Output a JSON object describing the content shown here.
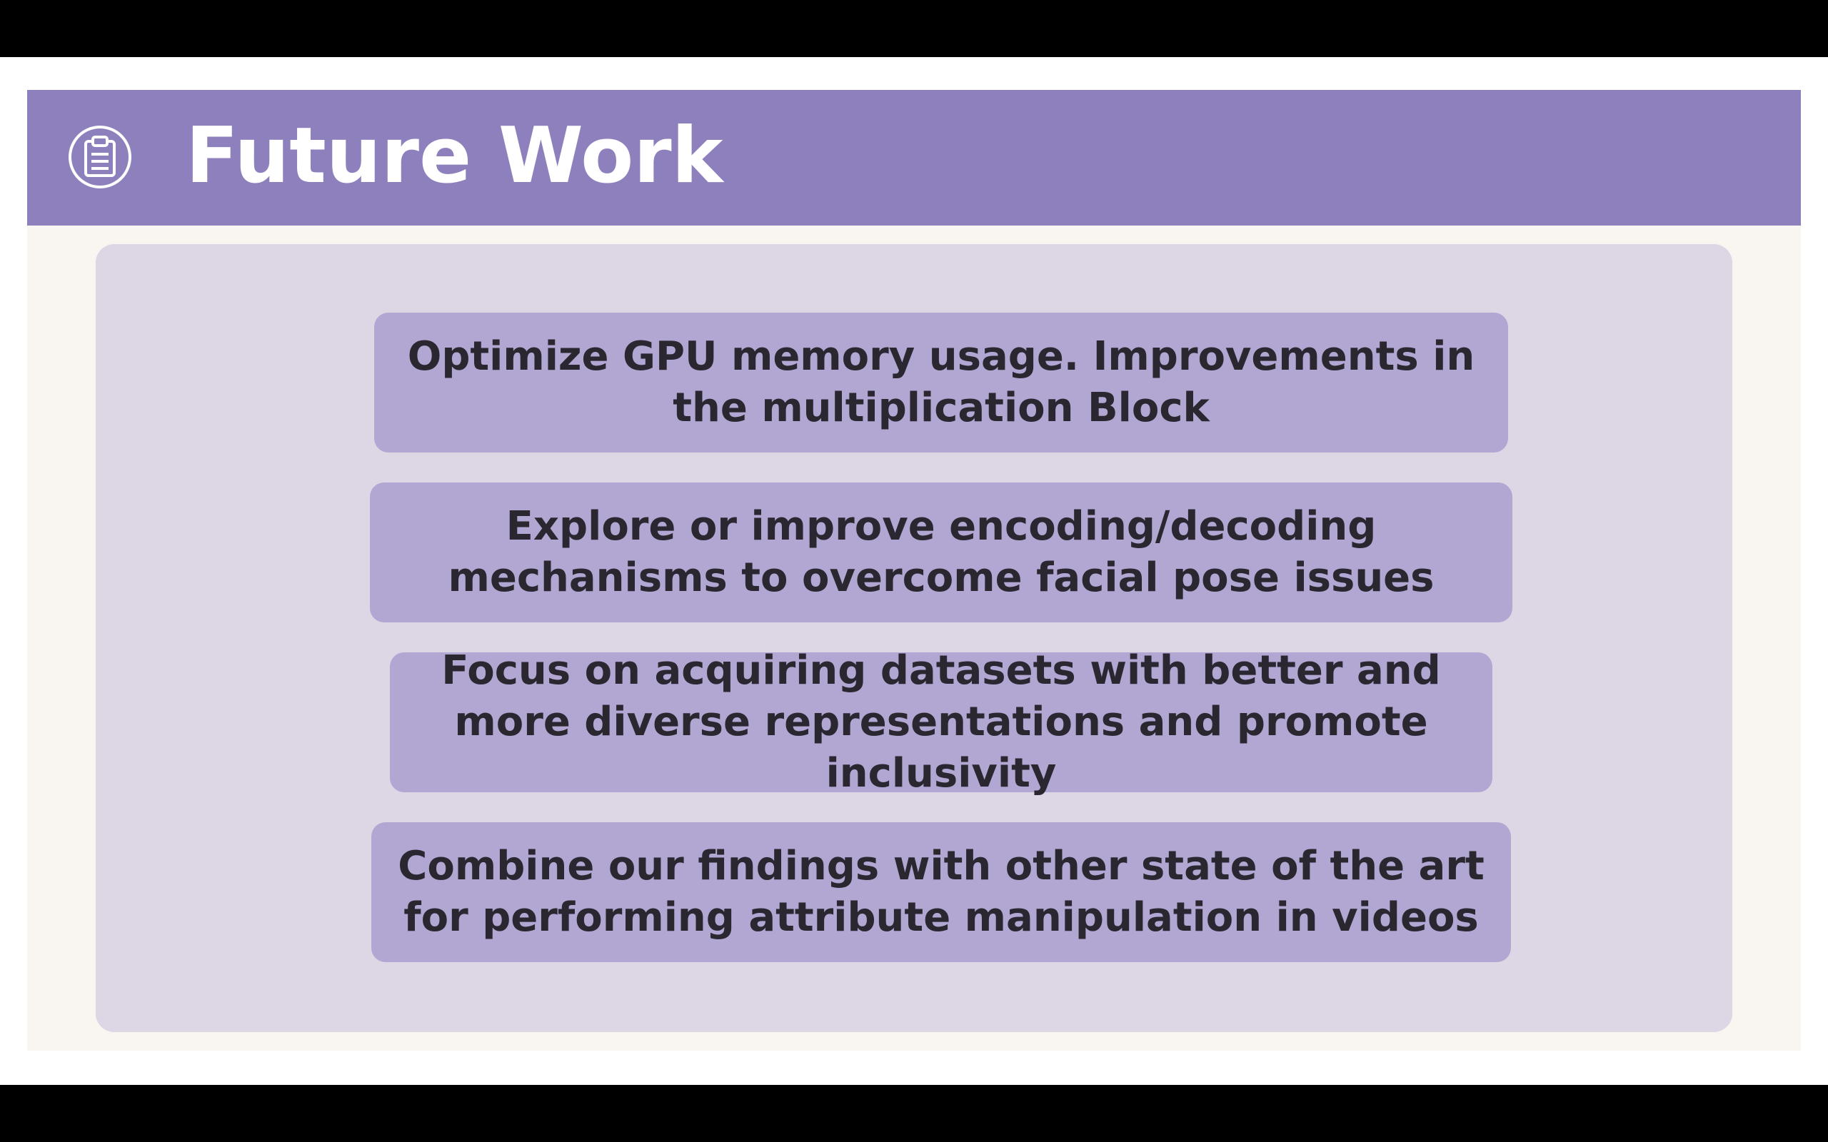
{
  "slide": {
    "title": "Future Work",
    "icon": "clipboard-icon",
    "colors": {
      "header": "#8e80bd",
      "panel": "#dcd6e5",
      "item": "#b2a6d2",
      "text": "#2a2730",
      "background": "#f9f5f1"
    },
    "items": [
      {
        "text": "Optimize GPU memory usage. Improvements in the multiplication Block"
      },
      {
        "text": "Explore or improve encoding/decoding mechanisms to overcome facial pose issues"
      },
      {
        "text": "Focus on acquiring datasets with better and more diverse representations and promote inclusivity"
      },
      {
        "text": "Combine our findings with other state of the art for performing attribute manipulation in videos"
      }
    ]
  }
}
